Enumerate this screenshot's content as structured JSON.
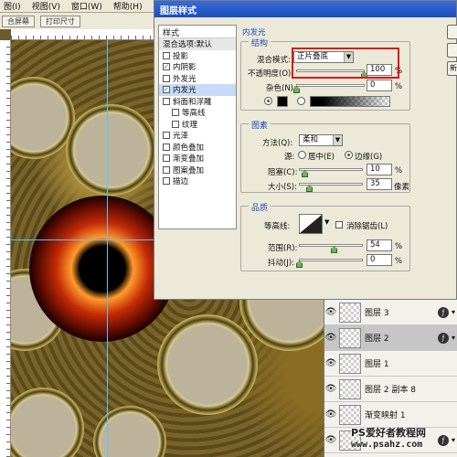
{
  "menubar": {
    "items": [
      "图(I)",
      "视图(V)",
      "窗口(W)",
      "帮助(H)"
    ]
  },
  "toolbar": {
    "button1": "合屏幕",
    "button2": "打印尺寸"
  },
  "dialog": {
    "title": "图层样式",
    "styles_header": "样式",
    "styles": [
      {
        "label": "混合选项:默认",
        "checked": null
      },
      {
        "label": "投影",
        "checked": false
      },
      {
        "label": "内阴影",
        "checked": true
      },
      {
        "label": "外发光",
        "checked": false
      },
      {
        "label": "内发光",
        "checked": true
      },
      {
        "label": "斜面和浮雕",
        "checked": false
      },
      {
        "label": "等高线",
        "checked": false
      },
      {
        "label": "纹理",
        "checked": false
      },
      {
        "label": "光泽",
        "checked": false
      },
      {
        "label": "颜色叠加",
        "checked": false
      },
      {
        "label": "渐变叠加",
        "checked": false
      },
      {
        "label": "图案叠加",
        "checked": false
      },
      {
        "label": "描边",
        "checked": false
      }
    ],
    "panel_title": "内发光",
    "structure": {
      "title": "结构",
      "blend_mode_label": "混合模式:",
      "blend_mode_value": "正片叠底",
      "opacity_label": "不透明度(O):",
      "opacity_value": "100",
      "opacity_unit": "%",
      "noise_label": "杂色(N):",
      "noise_value": "0",
      "noise_unit": "%"
    },
    "elements": {
      "title": "图素",
      "method_label": "方法(Q):",
      "method_value": "柔和",
      "source_label": "源:",
      "source_center": "居中(E)",
      "source_edge": "边缘(G)",
      "choke_label": "阻塞(C):",
      "choke_value": "10",
      "choke_unit": "%",
      "size_label": "大小(S):",
      "size_value": "35",
      "size_unit": "像素"
    },
    "quality": {
      "title": "品质",
      "contour_label": "等高线:",
      "anti_alias_label": "消除锯齿(L)",
      "range_label": "范围(R):",
      "range_value": "54",
      "range_unit": "%",
      "jitter_label": "抖动(J):",
      "jitter_value": "0",
      "jitter_unit": "%"
    },
    "side_button_label": "新"
  },
  "layers": [
    {
      "name": "图层 3",
      "selected": false,
      "fx": true
    },
    {
      "name": "图层 2",
      "selected": true,
      "fx": true
    },
    {
      "name": "图层 1",
      "selected": false,
      "fx": false
    },
    {
      "name": "图层 2 副本 8",
      "selected": false,
      "fx": false
    },
    {
      "name": "渐变映射 1",
      "selected": false,
      "fx": false
    },
    {
      "name": "",
      "selected": false,
      "fx": true
    }
  ],
  "watermark": {
    "line1": "PS爱好者教程网",
    "line2": "www.psahz.com"
  },
  "colors": {
    "highlight_box": "#d91818",
    "selection_blue": "#c9d9f7",
    "title_blue": "#1d4dbd",
    "guide": "#4fc6ff"
  }
}
